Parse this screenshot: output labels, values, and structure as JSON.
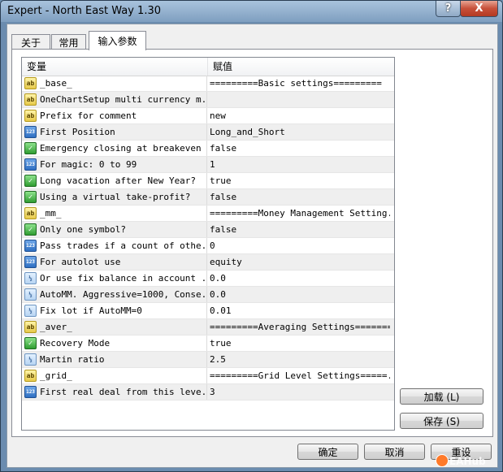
{
  "window": {
    "title": "Expert - North East Way 1.30",
    "help_label": "?",
    "close_label": "X"
  },
  "tabs": [
    {
      "label": "关于",
      "active": false
    },
    {
      "label": "常用",
      "active": false
    },
    {
      "label": "输入参数",
      "active": true
    }
  ],
  "grid": {
    "headers": {
      "variable": "变量",
      "value": "赋值"
    },
    "rows": [
      {
        "icon": "ab",
        "name": "_base_",
        "value": "=========Basic settings========="
      },
      {
        "icon": "ab",
        "name": "OneChartSetup multi currency m...",
        "value": ""
      },
      {
        "icon": "ab",
        "name": "Prefix for comment",
        "value": "new"
      },
      {
        "icon": "123",
        "name": "First Position",
        "value": "Long_and_Short"
      },
      {
        "icon": "bool",
        "name": "Emergency closing at breakeven",
        "value": "false"
      },
      {
        "icon": "123",
        "name": "For magic: 0 to 99",
        "value": "1"
      },
      {
        "icon": "bool",
        "name": "Long vacation after New Year?",
        "value": "true"
      },
      {
        "icon": "bool",
        "name": "Using a virtual take-profit?",
        "value": "false"
      },
      {
        "icon": "ab",
        "name": "_mm_",
        "value": "=========Money Management Setting..."
      },
      {
        "icon": "bool",
        "name": "Only one symbol?",
        "value": "false"
      },
      {
        "icon": "123",
        "name": "Pass trades if a count of othe...",
        "value": "0"
      },
      {
        "icon": "123",
        "name": "For autolot use",
        "value": "equity"
      },
      {
        "icon": "frac",
        "name": "Or use fix balance in account ...",
        "value": "0.0"
      },
      {
        "icon": "frac",
        "name": "AutoMM. Aggressive=1000, Conse...",
        "value": "0.0"
      },
      {
        "icon": "frac",
        "name": "Fix lot if AutoMM=0",
        "value": "0.01"
      },
      {
        "icon": "ab",
        "name": "_aver_",
        "value": "=========Averaging Settings========="
      },
      {
        "icon": "bool",
        "name": "Recovery Mode",
        "value": "true"
      },
      {
        "icon": "frac",
        "name": "Martin ratio",
        "value": "2.5"
      },
      {
        "icon": "ab",
        "name": "_grid_",
        "value": "=========Grid Level Settings=====..."
      },
      {
        "icon": "123",
        "name": "First real deal from this leve...",
        "value": "3"
      }
    ]
  },
  "icons": {
    "ab": "ab",
    "123": "123",
    "frac": "½",
    "bool": "✓"
  },
  "side_buttons": {
    "load": "加载 (L)",
    "save": "保存 (S)"
  },
  "footer_buttons": {
    "ok": "确定",
    "cancel": "取消",
    "reset": "重设"
  },
  "watermark": "EAHub"
}
